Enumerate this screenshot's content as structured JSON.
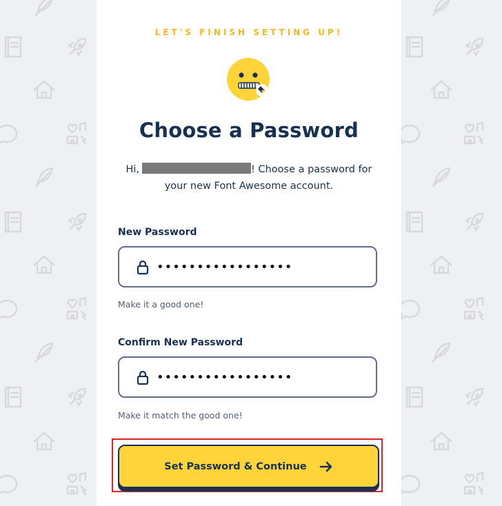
{
  "eyebrow": "LET'S FINISH SETTING UP!",
  "title": "Choose a Password",
  "intro": {
    "prefix": "Hi,",
    "suffix": "! Choose a password for your new Font Awesome account."
  },
  "new_password": {
    "label": "New Password",
    "value": "•••••••••••••••••",
    "hint": "Make it a good one!"
  },
  "confirm_password": {
    "label": "Confirm New Password",
    "value": "•••••••••••••••••",
    "hint": "Make it match the good one!"
  },
  "submit": {
    "label": "Set Password & Continue"
  },
  "icons": {
    "emoji": "zipper-mouth-face-icon",
    "lock": "lock-icon",
    "arrow": "arrow-right-icon",
    "pattern": [
      "feather-icon",
      "book-icon",
      "rocket-icon",
      "house-icon",
      "comment-icon",
      "heart-music-camera-icon"
    ]
  },
  "colors": {
    "accent_yellow": "#ffd43b",
    "eyebrow_gold": "#f6b81a",
    "navy": "#183153",
    "highlight_red": "#e02020"
  }
}
